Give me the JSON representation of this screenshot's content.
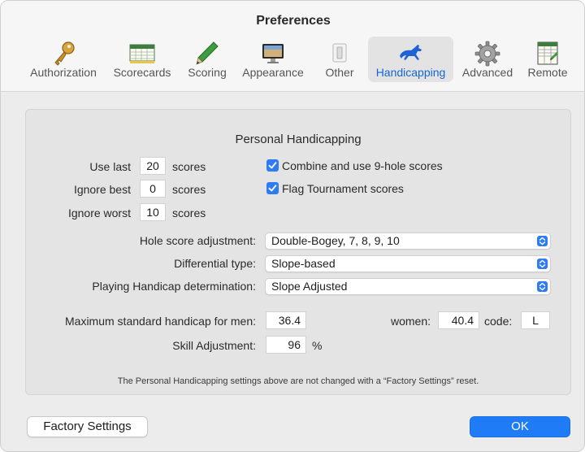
{
  "window": {
    "title": "Preferences"
  },
  "tabs": [
    {
      "label": "Authorization",
      "icon": "key-icon"
    },
    {
      "label": "Scorecards",
      "icon": "scorecard-icon"
    },
    {
      "label": "Scoring",
      "icon": "pencil-icon"
    },
    {
      "label": "Appearance",
      "icon": "monitor-icon"
    },
    {
      "label": "Other",
      "icon": "switch-icon"
    },
    {
      "label": "Handicapping",
      "icon": "horse-icon",
      "active": true
    },
    {
      "label": "Advanced",
      "icon": "gear-icon"
    },
    {
      "label": "Remote",
      "icon": "remote-scorecard-icon"
    }
  ],
  "section": {
    "title": "Personal Handicapping"
  },
  "scores": {
    "use_last_label": "Use last",
    "use_last_value": "20",
    "ignore_best_label": "Ignore best",
    "ignore_best_value": "0",
    "ignore_worst_label": "Ignore worst",
    "ignore_worst_value": "10",
    "unit": "scores"
  },
  "options": {
    "combine_label": "Combine and use 9-hole scores",
    "combine_checked": true,
    "flag_label": "Flag Tournament scores",
    "flag_checked": true
  },
  "adjustments": {
    "hole_score_label": "Hole score adjustment:",
    "hole_score_value": "Double-Bogey, 7, 8, 9, 10",
    "differential_label": "Differential type:",
    "differential_value": "Slope-based",
    "playing_label": "Playing Handicap determination:",
    "playing_value": "Slope Adjusted"
  },
  "limits": {
    "men_label": "Maximum standard handicap for men:",
    "men_value": "36.4",
    "women_label": "women:",
    "women_value": "40.4",
    "code_label": "code:",
    "code_value": "L",
    "skill_label": "Skill Adjustment:",
    "skill_value": "96",
    "skill_unit": "%"
  },
  "footnote": "The Personal Handicapping settings above are not changed with a “Factory Settings” reset.",
  "buttons": {
    "factory": "Factory Settings",
    "ok": "OK"
  },
  "colors": {
    "accent": "#1f7cf6",
    "active_tab_text": "#1466d8",
    "panel": "#e4e4e4"
  }
}
